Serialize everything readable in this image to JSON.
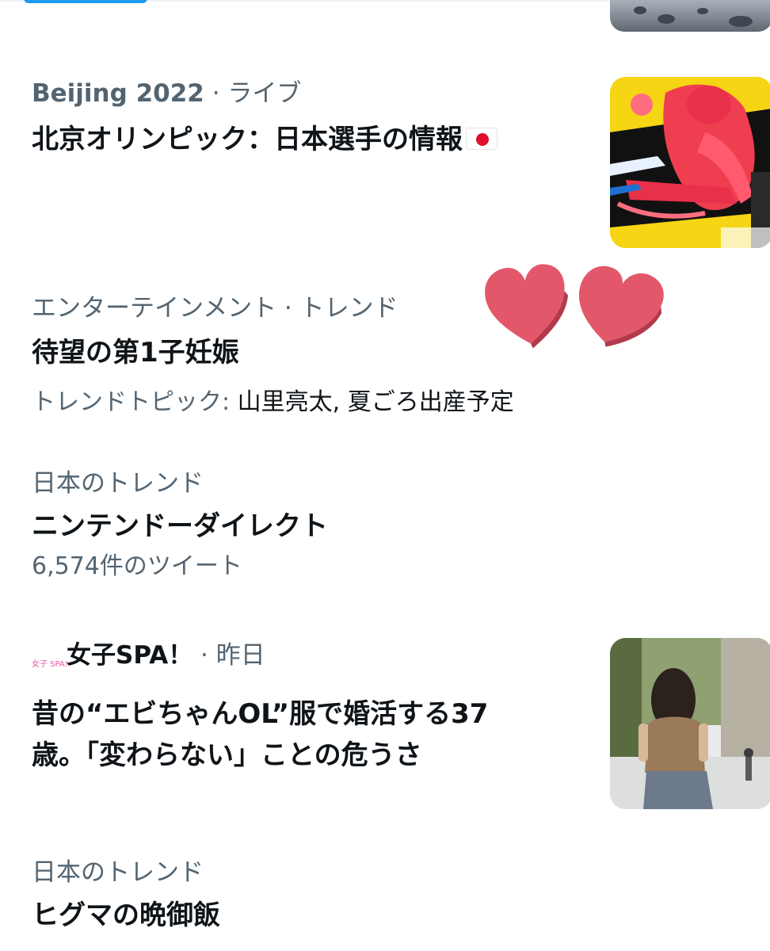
{
  "trends": [
    {
      "category": "Beijing 2022",
      "label": "ライブ",
      "title": "北京オリンピック：日本選手の情報"
    },
    {
      "category": "エンターテインメント",
      "label": "トレンド",
      "title": "待望の第1子妊娠",
      "topic_label": "トレンドトピック:",
      "topic_value": "山里亮太, 夏ごろ出産予定"
    },
    {
      "category": "日本のトレンド",
      "title": "ニンテンドーダイレクト",
      "count": "6,574件のツイート"
    },
    {
      "source": "女子SPA！",
      "time": "昨日",
      "logo_text": "女子 SPA!",
      "title_line1": "昔の“エビちゃんOL”服で婚活する37",
      "title_line2": "歳。「変わらない」ことの危うさ"
    },
    {
      "category": "日本のトレンド",
      "title": "ヒグマの晩御飯"
    }
  ],
  "separator": " · ",
  "colors": {
    "primary_text": "#0f1419",
    "secondary_text": "#536471",
    "accent": "#1d9bf0",
    "heart": "#e2586a"
  },
  "icons": [
    "japan-flag-icon",
    "heart-icon",
    "joshi-spa-logo-icon"
  ]
}
